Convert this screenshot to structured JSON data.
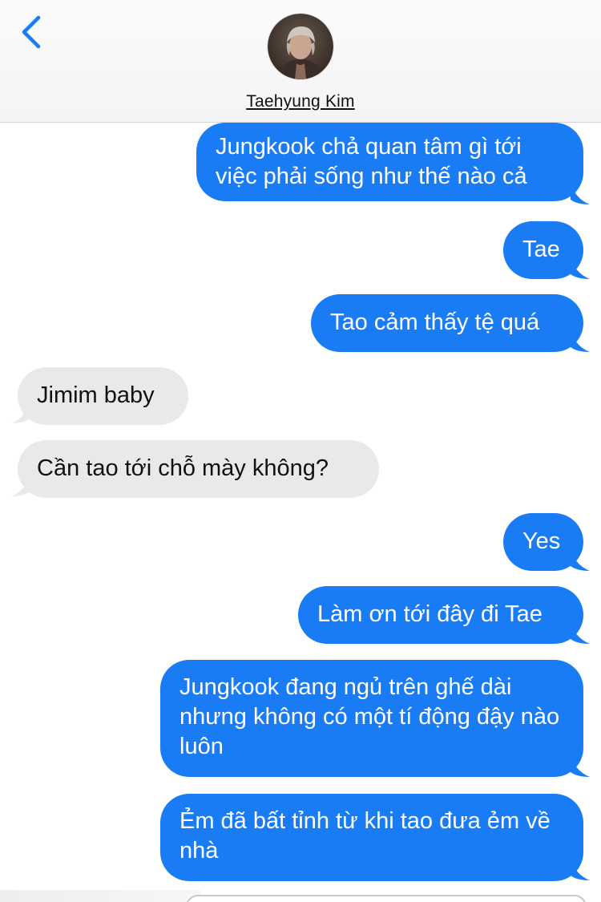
{
  "header": {
    "contact_name": "Taehyung Kim",
    "back_icon": "chevron-left-icon",
    "avatar_icon": "contact-avatar"
  },
  "colors": {
    "sent_bubble": "#1a7cf5",
    "received_bubble": "#e9e9eb",
    "accent": "#1a7cf5"
  },
  "messages": [
    {
      "direction": "sent",
      "text": "Jungkook chả quan tâm gì tới việc phải sống như thế nào cả"
    },
    {
      "direction": "sent",
      "text": "Tae"
    },
    {
      "direction": "sent",
      "text": "Tao cảm thấy tệ quá"
    },
    {
      "direction": "received",
      "text": "Jimim baby"
    },
    {
      "direction": "received",
      "text": "Cần tao tới chỗ mày không?"
    },
    {
      "direction": "sent",
      "text": "Yes"
    },
    {
      "direction": "sent",
      "text": "Làm ơn tới đây đi Tae"
    },
    {
      "direction": "sent",
      "text": "Jungkook đang ngủ trên ghế dài nhưng không có một tí động đậy nào luôn"
    },
    {
      "direction": "sent",
      "text": "Ẻm đã bất tỉnh từ khi tao đưa ẻm về nhà"
    }
  ]
}
